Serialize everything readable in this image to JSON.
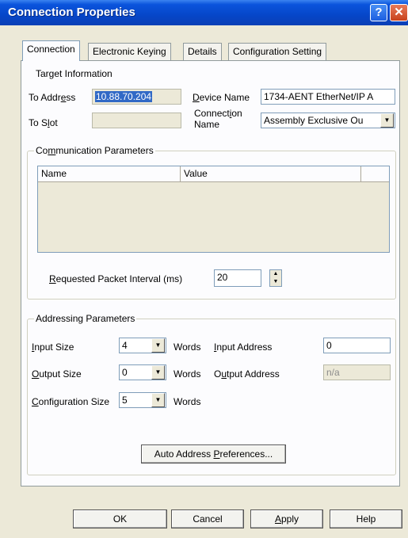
{
  "window": {
    "title": "Connection Properties"
  },
  "tabs": [
    {
      "label": "Connection",
      "active": true
    },
    {
      "label": "Electronic Keying"
    },
    {
      "label": "Details"
    },
    {
      "label": "Configuration Setting"
    }
  ],
  "target": {
    "group_label": "Target Information",
    "to_address_label": "To Address",
    "to_address_value": "10.88.70.204",
    "to_slot_label": "To Slot",
    "to_slot_value": "",
    "device_name_label": "Device Name",
    "device_name_value": "1734-AENT EtherNet/IP A",
    "connection_name_label_1": "Connection",
    "connection_name_label_2": "Name",
    "connection_name_value": "Assembly Exclusive Ou"
  },
  "comm": {
    "group_label": "Communication Parameters",
    "columns": [
      "Name",
      "Value"
    ],
    "rpi_label": "Requested Packet Interval (ms)",
    "rpi_value": "20"
  },
  "addressing": {
    "group_label": "Addressing Parameters",
    "input_size_label": "Input Size",
    "input_size_value": "4",
    "output_size_label": "Output Size",
    "output_size_value": "0",
    "config_size_label": "Configuration Size",
    "config_size_value": "5",
    "words_label": "Words",
    "input_address_label": "Input Address",
    "input_address_value": "0",
    "output_address_label": "Output Address",
    "output_address_value": "n/a",
    "auto_address_button": "Auto Address Preferences..."
  },
  "buttons": {
    "ok": "OK",
    "cancel": "Cancel",
    "apply": "Apply",
    "help": "Help"
  },
  "icons": {
    "help": "help-icon",
    "close": "close-icon",
    "dropdown": "dropdown-arrow-icon",
    "spin_up": "spin-up-icon",
    "spin_down": "spin-down-icon"
  },
  "colors": {
    "titlebar": "#0a54dc",
    "selection": "#3169c6",
    "dialog_bg": "#ece9d8"
  }
}
